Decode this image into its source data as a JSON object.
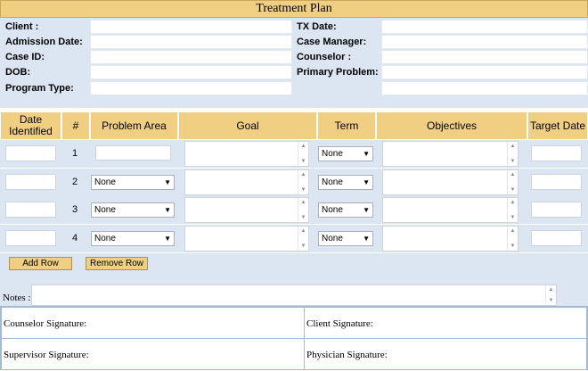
{
  "title": "Treatment Plan",
  "info": {
    "client_label": "Client :",
    "tx_date_label": "TX Date:",
    "admission_label": "Admission Date:",
    "case_manager_label": "Case Manager:",
    "case_id_label": "Case ID:",
    "counselor_label": "Counselor :",
    "dob_label": "DOB:",
    "primary_problem_label": "Primary Problem:",
    "program_type_label": "Program Type:"
  },
  "grid": {
    "headers": {
      "date_identified": "Date Identified",
      "number": "#",
      "problem_area": "Problem Area",
      "goal": "Goal",
      "term": "Term",
      "objectives": "Objectives",
      "target_date": "Target Date"
    },
    "rows": [
      {
        "num": "1",
        "problem_area": "",
        "term": "None"
      },
      {
        "num": "2",
        "problem_area": "None",
        "term": "None"
      },
      {
        "num": "3",
        "problem_area": "None",
        "term": "None"
      },
      {
        "num": "4",
        "problem_area": "None",
        "term": "None"
      }
    ]
  },
  "buttons": {
    "add_row": "Add Row",
    "remove_row": "Remove Row"
  },
  "notes": {
    "label": "Notes :"
  },
  "signatures": {
    "counselor": "Counselor Signature:",
    "client": "Client Signature:",
    "supervisor": "Supervisor Signature:",
    "physician": "Physician Signature:"
  },
  "icons": {
    "select_arrow": "dropdown-arrow-icon",
    "scroll_up": "scroll-up-icon",
    "scroll_down": "scroll-down-icon"
  },
  "colors": {
    "header_gold": "#f0cf82",
    "panel_blue": "#dce6f2",
    "border_blue": "#9fbbd8"
  }
}
